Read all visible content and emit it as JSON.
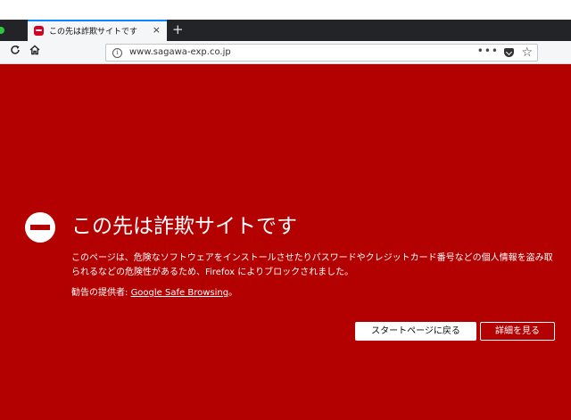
{
  "browser": {
    "tab": {
      "title": "この先は詐欺サイトです",
      "favicon": "blocked-icon",
      "close_label": "×"
    },
    "new_tab_label": "+",
    "nav": {
      "reload_icon": "reload-icon",
      "home_icon": "home-icon"
    },
    "urlbar": {
      "info_label": "i",
      "url": "www.sagawa-exp.co.jp",
      "page_actions_label": "•••"
    }
  },
  "error_page": {
    "title": "この先は詐欺サイトです",
    "description": "このページは、危険なソフトウェアをインストールさせたりパスワードやクレジットカード番号などの個人情報を盗み取られるなどの危険性があるため、Firefox によりブロックされました。",
    "advisory_prefix": "勧告の提供者: ",
    "advisory_link": "Google Safe Browsing",
    "advisory_suffix": "。",
    "buttons": {
      "start_page": "スタートページに戻る",
      "details": "詳細を見る"
    }
  },
  "colors": {
    "error_background": "#b30000",
    "tab_bar": "#222427",
    "accent": "#0a84ff"
  }
}
